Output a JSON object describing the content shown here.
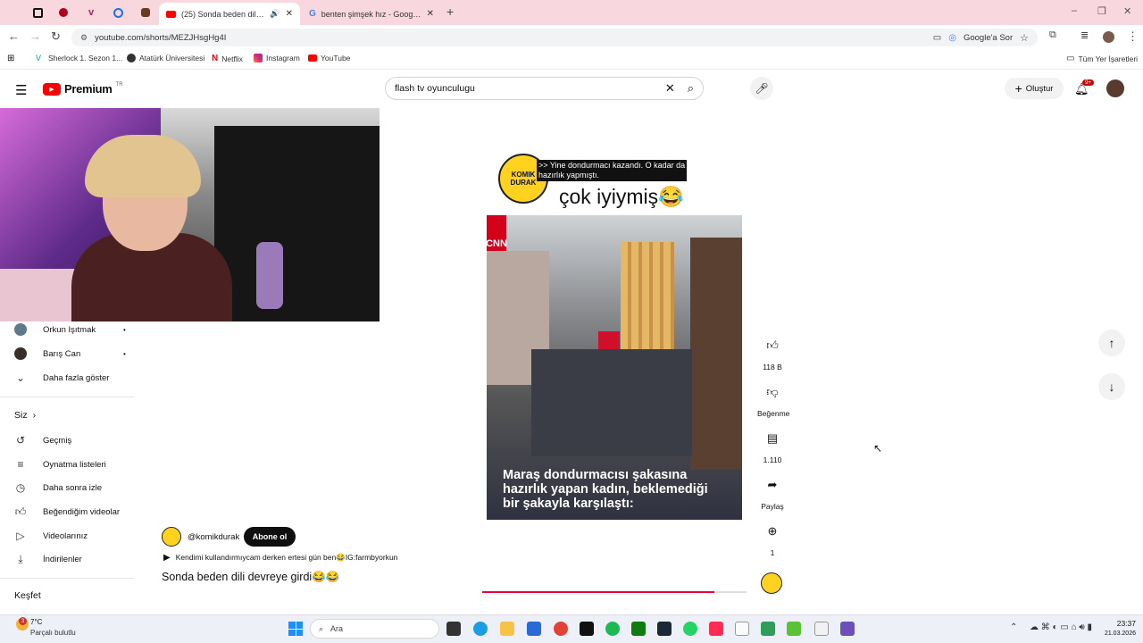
{
  "browser": {
    "tabs": [
      {
        "title": "(25) Sonda beden dili devr",
        "active": true
      },
      {
        "title": "benten şimşek hız - Google'da",
        "active": false
      }
    ],
    "url": "youtube.com/shorts/MEZJHsgHg4I",
    "google_ask": "Google'a Sor",
    "bookmarks": [
      "Sherlock 1. Sezon 1...",
      "Atatürk Üniversitesi",
      "Netflix",
      "Instagram",
      "YouTube"
    ],
    "all_bookmarks": "Tüm Yer İşaretleri"
  },
  "youtube": {
    "logo": "Premium",
    "logo_sup": "TR",
    "search_value": "flash tv oyunculugu",
    "create_label": "Oluştur",
    "notif_count": "9+"
  },
  "sidebar": {
    "subs": [
      {
        "name": "Orkun Işıtmak"
      },
      {
        "name": "Barış Can"
      }
    ],
    "show_more": "Daha fazla göster",
    "you_title": "Siz",
    "you_items": [
      {
        "label": "Geçmiş",
        "icon": "history-icon"
      },
      {
        "label": "Oynatma listeleri",
        "icon": "playlist-icon"
      },
      {
        "label": "Daha sonra izle",
        "icon": "clock-icon"
      },
      {
        "label": "Beğendiğim videolar",
        "icon": "thumb-up-icon"
      },
      {
        "label": "Videolarınız",
        "icon": "video-icon"
      },
      {
        "label": "İndirilenler",
        "icon": "download-icon"
      }
    ],
    "explore_title": "Keşfet"
  },
  "short": {
    "channel_badge": "KOMIK DURAK",
    "caption_line1": ">> Yine dondurmacı kazandı. O kadar da",
    "caption_line2": "hazırlık yapmıştı.",
    "headline": "çok iyiymiş😂",
    "video_overlay": "Maraş dondurmacısı şakasına hazırlık yapan kadın, beklemediği bir şakayla karşılaştı:",
    "channel": "@komikdurak",
    "subscribe": "Abone ol",
    "description": "Kendimi kullandırmıycam derken ertesi gün ben😂IG:farmbyorkun",
    "title": "Sonda beden dili devreye girdi😂😂"
  },
  "actions": {
    "likes": "118 B",
    "dislike": "Beğenme",
    "comments": "1.110",
    "share": "Paylaş",
    "remix": "1"
  },
  "taskbar": {
    "weather_temp": "7°C",
    "weather_desc": "Parçalı bulutlu",
    "weather_badge": "3",
    "search": "Ara",
    "time": "23:37",
    "date": "21.03.2026"
  },
  "colors": {
    "tabstrip": "#f8d7de",
    "yt_red": "#ff0000",
    "progress": "#e8003d"
  }
}
